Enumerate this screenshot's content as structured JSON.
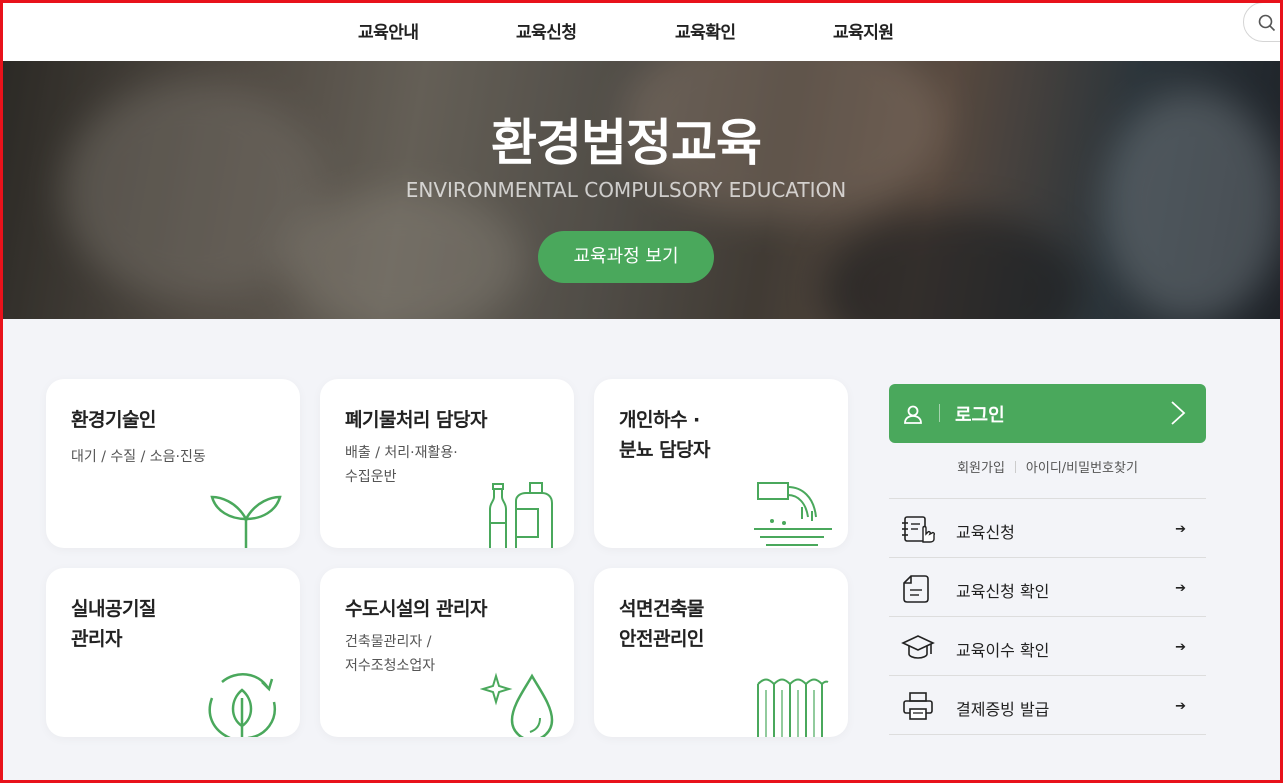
{
  "nav": {
    "items": [
      {
        "label": "교육안내"
      },
      {
        "label": "교육신청"
      },
      {
        "label": "교육확인"
      },
      {
        "label": "교육지원"
      }
    ]
  },
  "hero": {
    "title": "환경법정교육",
    "subtitle": "ENVIRONMENTAL COMPULSORY EDUCATION",
    "button_label": "교육과정 보기"
  },
  "cards": [
    {
      "title": "환경기술인",
      "desc": "대기 / 수질 / 소음·진동",
      "icon": "sprout-icon"
    },
    {
      "title": "폐기물처리 담당자",
      "desc_line1": "배출 / 처리·재활용·",
      "desc_line2": "수집운반",
      "icon": "bottles-icon"
    },
    {
      "title_line1": "개인하수 ·",
      "title_line2": "분뇨 담당자",
      "icon": "drain-pipe-icon"
    },
    {
      "title_line1": "실내공기질",
      "title_line2": "관리자",
      "icon": "recycle-leaf-icon"
    },
    {
      "title": "수도시설의 관리자",
      "desc_line1": "건축물관리자 /",
      "desc_line2": "저수조청소업자",
      "icon": "water-drop-icon"
    },
    {
      "title_line1": "석면건축물",
      "title_line2": "안전관리인",
      "icon": "asbestos-roof-icon"
    }
  ],
  "login": {
    "label": "로그인",
    "signup": "회원가입",
    "find": "아이디/비밀번호찾기"
  },
  "menu": [
    {
      "label": "교육신청",
      "icon": "apply-form-icon"
    },
    {
      "label": "교육신청 확인",
      "icon": "document-check-icon"
    },
    {
      "label": "교육이수 확인",
      "icon": "graduation-cap-icon"
    },
    {
      "label": "결제증빙 발급",
      "icon": "printer-icon"
    }
  ],
  "colors": {
    "accent": "#4aa85c",
    "frame": "#e8121b",
    "background": "#f3f4f8"
  }
}
